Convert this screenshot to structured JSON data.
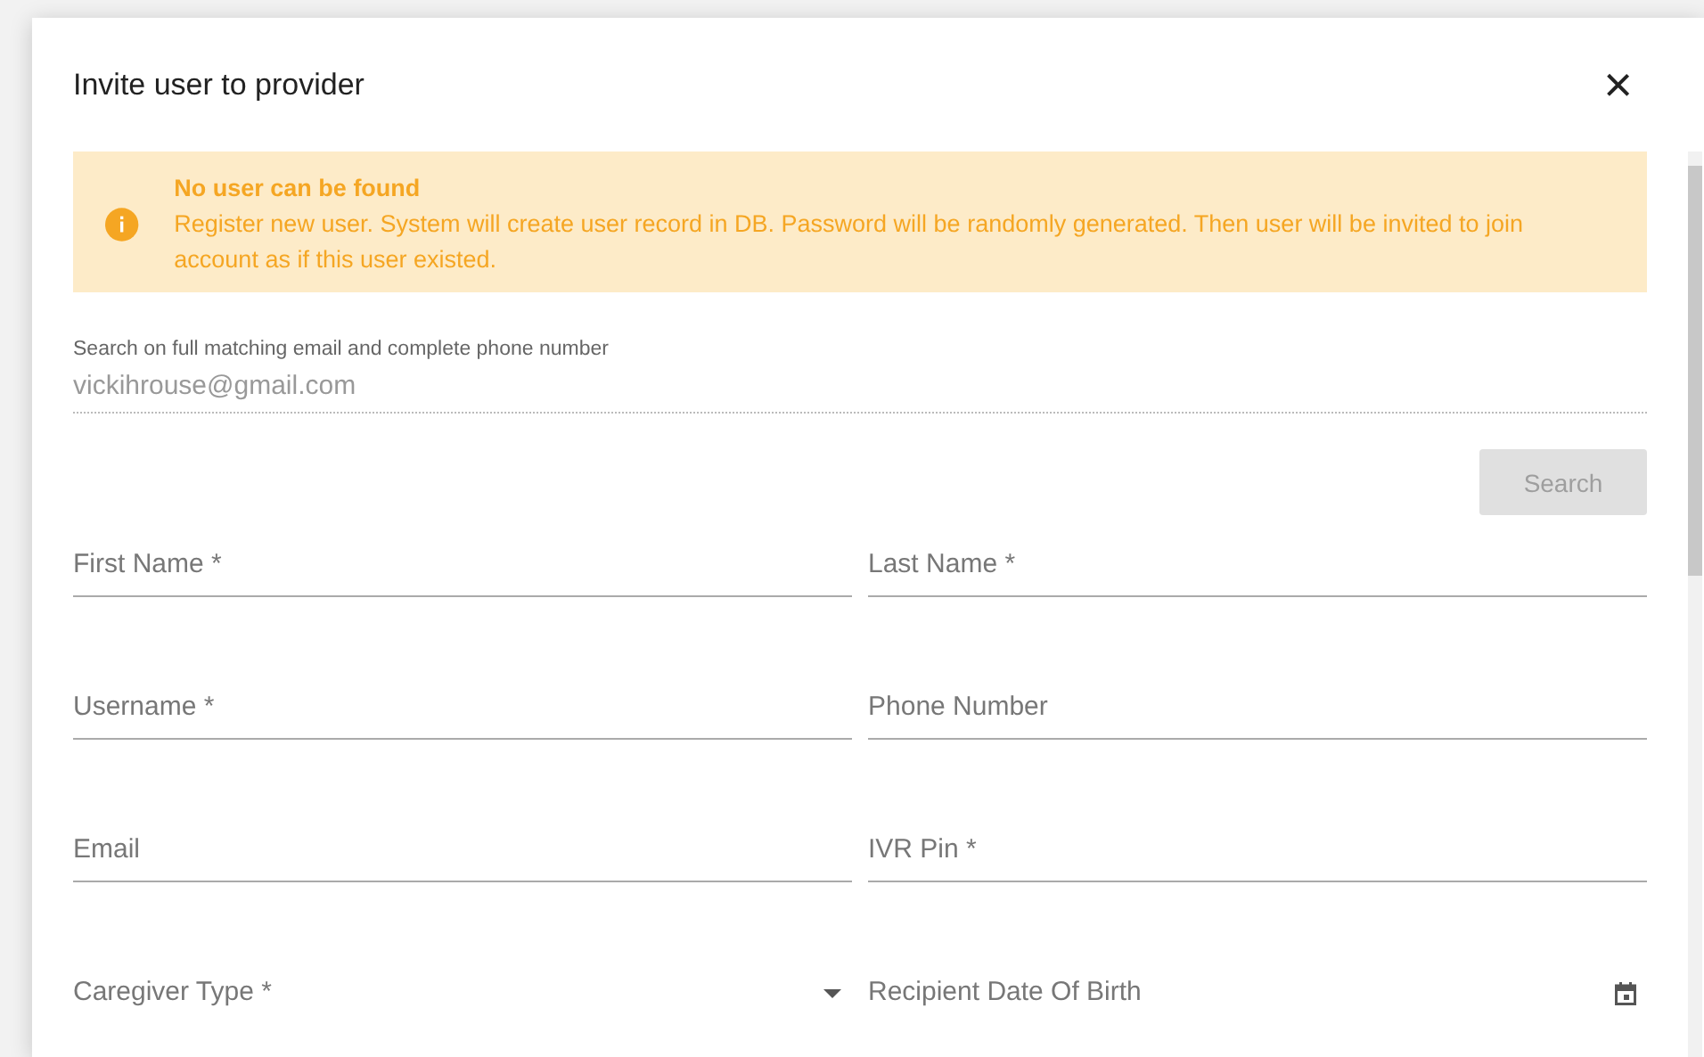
{
  "dialog": {
    "title": "Invite user to provider",
    "close_icon": "×"
  },
  "alert": {
    "title": "No user can be found",
    "message": "Register new user. System will create user record in DB. Password will be randomly generated. Then user will be invited to join account as if this user existed."
  },
  "search": {
    "label": "Search on full matching email and complete phone number",
    "value": "vickihrouse@gmail.com",
    "button": {
      "label": "Search",
      "disabled": true
    }
  },
  "fields": [
    {
      "placeholder": "First Name *",
      "kind": "text"
    },
    {
      "placeholder": "Last Name *",
      "kind": "text"
    },
    {
      "placeholder": "Username *",
      "kind": "text"
    },
    {
      "placeholder": "Phone Number",
      "kind": "text"
    },
    {
      "placeholder": "Email",
      "kind": "text"
    },
    {
      "placeholder": "IVR Pin *",
      "kind": "text"
    },
    {
      "placeholder": "Caregiver Type *",
      "kind": "select"
    },
    {
      "placeholder": "Recipient Date Of Birth",
      "kind": "date"
    }
  ]
}
